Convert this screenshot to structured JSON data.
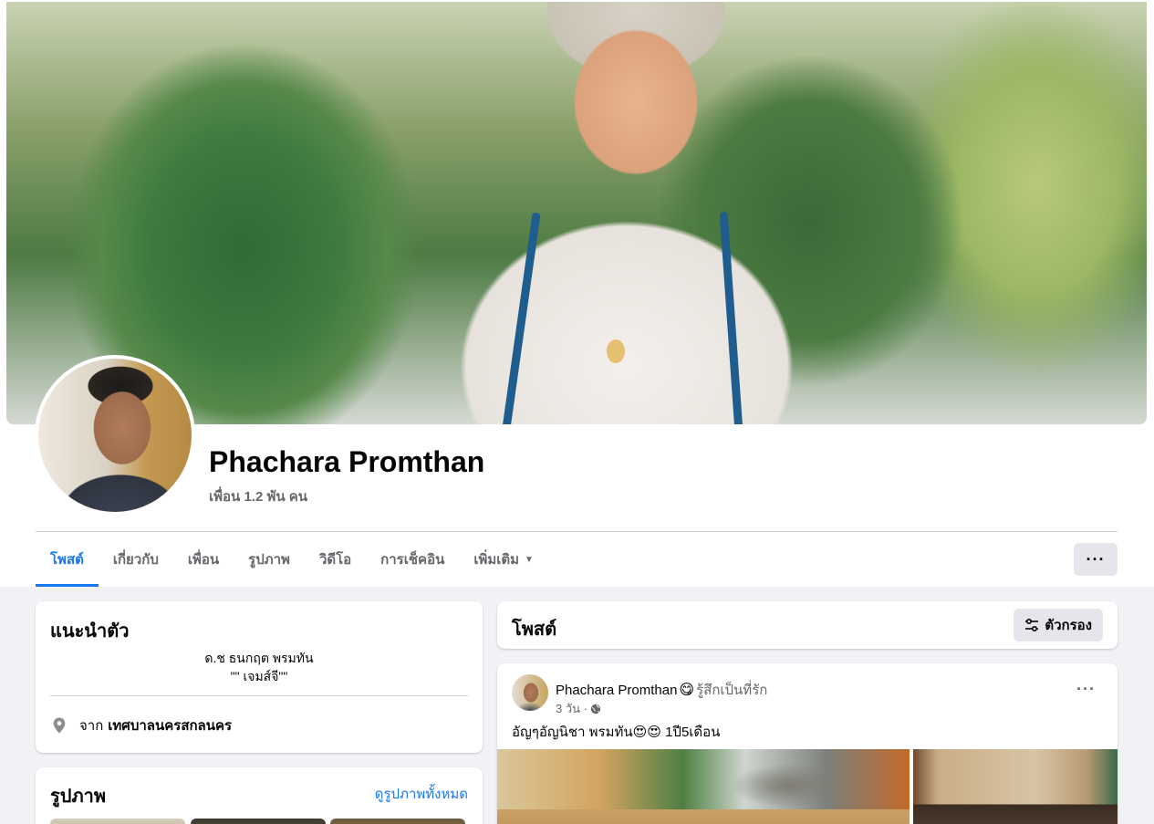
{
  "profile": {
    "name": "Phachara Promthan",
    "friends_text": "เพื่อน 1.2 พัน คน"
  },
  "tabs": [
    {
      "label": "โพสต์",
      "active": true
    },
    {
      "label": "เกี่ยวกับ",
      "active": false
    },
    {
      "label": "เพื่อน",
      "active": false
    },
    {
      "label": "รูปภาพ",
      "active": false
    },
    {
      "label": "วิดีโอ",
      "active": false
    },
    {
      "label": "การเช็คอิน",
      "active": false
    },
    {
      "label": "เพิ่มเติม",
      "active": false
    }
  ],
  "more_button_label": "···",
  "intro": {
    "title": "แนะนำตัว",
    "bio_line1": "ด.ช ธนกฤต พรมทัน",
    "bio_line2": "\"\" เจมส์จี\"\"",
    "from_label": "จาก",
    "from_place": "เทศบาลนครสกลนคร"
  },
  "photos": {
    "title": "รูปภาพ",
    "see_all": "ดูรูปภาพทั้งหมด"
  },
  "posts": {
    "title": "โพสต์",
    "filter_label": "ตัวกรอง"
  },
  "post": {
    "author": "Phachara Promthan",
    "feeling_emoji": "😋",
    "feeling_text": "รู้สึกเป็นที่รัก",
    "time": "3 วัน ·",
    "text": "อัญๆอัญนิชา พรมทัน😍😍 1ปี5เดือน",
    "more_label": "···"
  },
  "colors": {
    "accent": "#1877f2",
    "secondary_text": "#65676b",
    "background": "#f0f2f5"
  }
}
